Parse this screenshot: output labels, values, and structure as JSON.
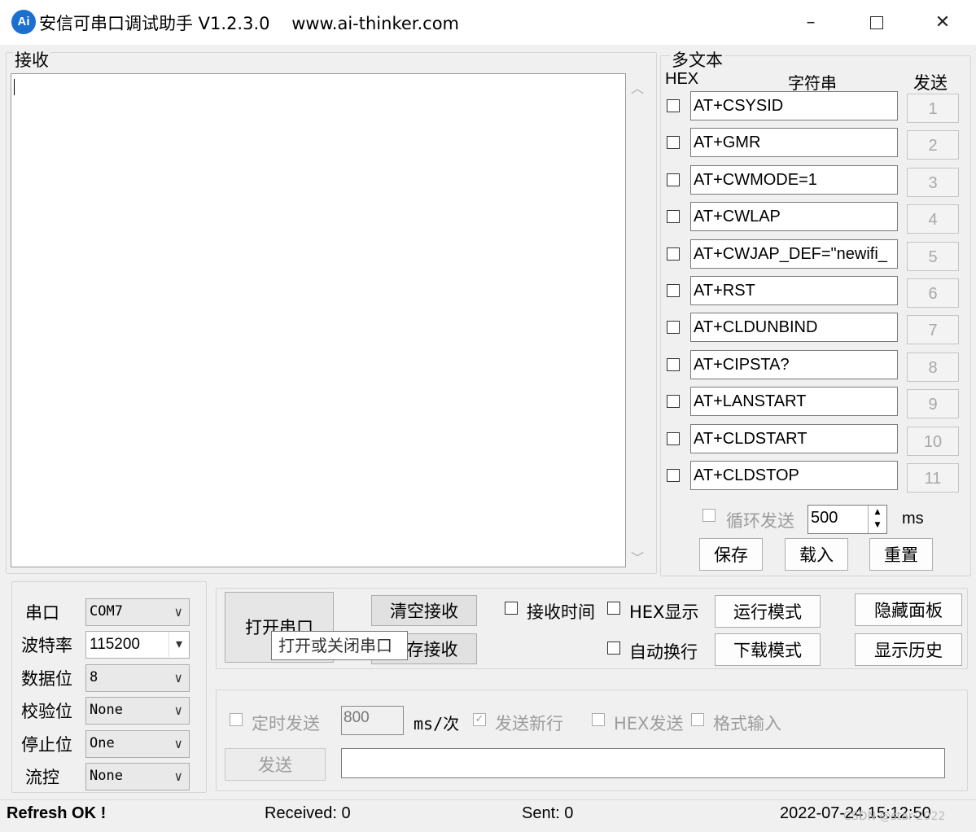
{
  "window": {
    "logo_text": "Ai",
    "title": "安信可串口调试助手 V1.2.3.0    www.ai-thinker.com",
    "minimize": "–",
    "close": "✕"
  },
  "receive": {
    "label": "接收"
  },
  "multi": {
    "label": "多文本",
    "hex_header": "HEX",
    "string_header": "字符串",
    "send_header": "发送",
    "rows": [
      {
        "text": "AT+CSYSID",
        "num": "1"
      },
      {
        "text": "AT+GMR",
        "num": "2"
      },
      {
        "text": "AT+CWMODE=1",
        "num": "3"
      },
      {
        "text": "AT+CWLAP",
        "num": "4"
      },
      {
        "text": "AT+CWJAP_DEF=\"newifi_",
        "num": "5"
      },
      {
        "text": "AT+RST",
        "num": "6"
      },
      {
        "text": "AT+CLDUNBIND",
        "num": "7"
      },
      {
        "text": "AT+CIPSTA?",
        "num": "8"
      },
      {
        "text": "AT+LANSTART",
        "num": "9"
      },
      {
        "text": "AT+CLDSTART",
        "num": "10"
      },
      {
        "text": "AT+CLDSTOP",
        "num": "11"
      }
    ],
    "loop_label": "循环发送",
    "loop_value": "500",
    "loop_unit": "ms",
    "save": "保存",
    "load": "载入",
    "reset": "重置"
  },
  "port": {
    "port_label": "串口",
    "port_value": "COM7",
    "baud_label": "波特率",
    "baud_value": "115200",
    "data_label": "数据位",
    "data_value": "8",
    "parity_label": "校验位",
    "parity_value": "None",
    "stop_label": "停止位",
    "stop_value": "One",
    "flow_label": "流控",
    "flow_value": "None"
  },
  "controls": {
    "open_port": "打开串口",
    "tooltip": "打开或关闭串口",
    "clear_recv": "清空接收",
    "save_recv": "存接收",
    "recv_time": "接收时间",
    "hex_display": "HEX显示",
    "auto_newline": "自动换行",
    "run_mode": "运行模式",
    "download_mode": "下载模式",
    "hide_panel": "隐藏面板",
    "show_history": "显示历史"
  },
  "send": {
    "timed_send": "定时发送",
    "interval": "800",
    "interval_unit": "ms/次",
    "send_newline": "发送新行",
    "hex_send": "HEX发送",
    "format_input": "格式输入",
    "send_button": "发送",
    "input_value": ""
  },
  "status": {
    "refresh": "Refresh OK !",
    "received": "Received: 0",
    "sent": "Sent: 0",
    "time": "2022-07-24 15:12:50",
    "watermark": "CSDN @star-2022"
  }
}
